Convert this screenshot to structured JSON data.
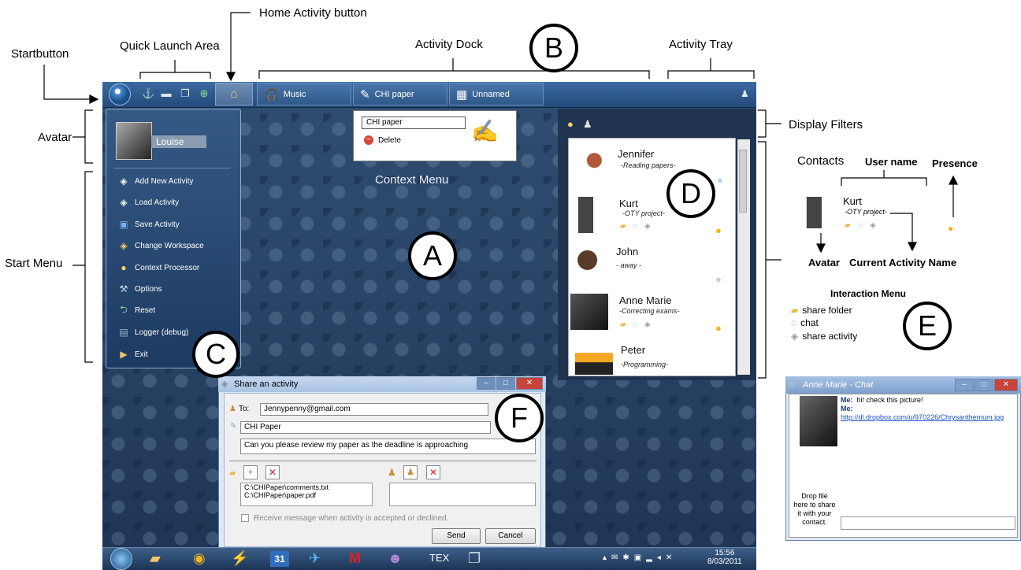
{
  "annotations": {
    "startbutton": "Startbutton",
    "quick_launch": "Quick Launch Area",
    "home_activity": "Home Activity button",
    "activity_dock": "Activity Dock",
    "activity_tray": "Activity Tray",
    "avatar": "Avatar",
    "start_menu": "Start Menu",
    "display_filters": "Display Filters",
    "context_menu": "Context Menu",
    "circles": {
      "a": "A",
      "b": "B",
      "c": "C",
      "d": "D",
      "e": "E",
      "f": "F"
    }
  },
  "dock": {
    "tabs": [
      {
        "label": "Music",
        "icon": "headphones-icon"
      },
      {
        "label": "CHI paper",
        "icon": "pen-paper-icon"
      },
      {
        "label": "Unnamed",
        "icon": "blocks-icon"
      }
    ]
  },
  "start_menu": {
    "user": "Louise",
    "items": [
      {
        "label": "Add New Activity",
        "icon": "cube-icon"
      },
      {
        "label": "Load Activity",
        "icon": "cube-icon"
      },
      {
        "label": "Save Activity",
        "icon": "floppy-icon"
      },
      {
        "label": "Change Workspace",
        "icon": "cube-icon"
      },
      {
        "label": "Context Processor",
        "icon": "bulb-icon"
      },
      {
        "label": "Options",
        "icon": "wrench-icon"
      },
      {
        "label": "Reset",
        "icon": "reset-icon"
      },
      {
        "label": "Logger (debug)",
        "icon": "console-icon"
      },
      {
        "label": "Exit",
        "icon": "exit-icon"
      }
    ]
  },
  "context_menu": {
    "input_value": "CHI paper",
    "delete_label": "Delete"
  },
  "contacts": [
    {
      "name": "Jennifer",
      "activity": "-Reading papers-"
    },
    {
      "name": "Kurt",
      "activity": "-OTY project-"
    },
    {
      "name": "John",
      "activity": "- away -"
    },
    {
      "name": "Anne Marie",
      "activity": "-Correcting exams-"
    },
    {
      "name": "Peter",
      "activity": "-Programming-"
    }
  ],
  "legend": {
    "contacts": "Contacts",
    "user_name": "User name",
    "presence": "Presence",
    "example_name": "Kurt",
    "example_activity": "-OTY project-",
    "avatar": "Avatar",
    "current_activity_name": "Current  Activity  Name",
    "interaction_menu": "Interaction Menu",
    "share_folder": "share  folder",
    "chat": "chat",
    "share_activity": "share  activity"
  },
  "share_window": {
    "title": "Share an activity",
    "to_label": "To:",
    "to_value": "Jennypenny@gmail.com",
    "activity_value": "CHI Paper",
    "message": "Can you please review my paper as the deadline is approaching",
    "files": [
      "C:\\CHIPaper\\comments.txt",
      "C:\\CHIPaper\\paper.pdf"
    ],
    "checkbox_label": "Receive message when activity is accepted or declined.",
    "send": "Send",
    "cancel": "Cancel"
  },
  "taskbar": {
    "time": "15:56",
    "date": "8/03/2011",
    "calendar_day": "31"
  },
  "chat_window": {
    "title": "Anne Marie - Chat",
    "sender": "Me:",
    "line1": "hi! check this picture!",
    "link": "http://dl.dropbox.com/u/970226/Chrysanthemum.jpg",
    "drop_text": "Drop file here to share it with your contact."
  }
}
